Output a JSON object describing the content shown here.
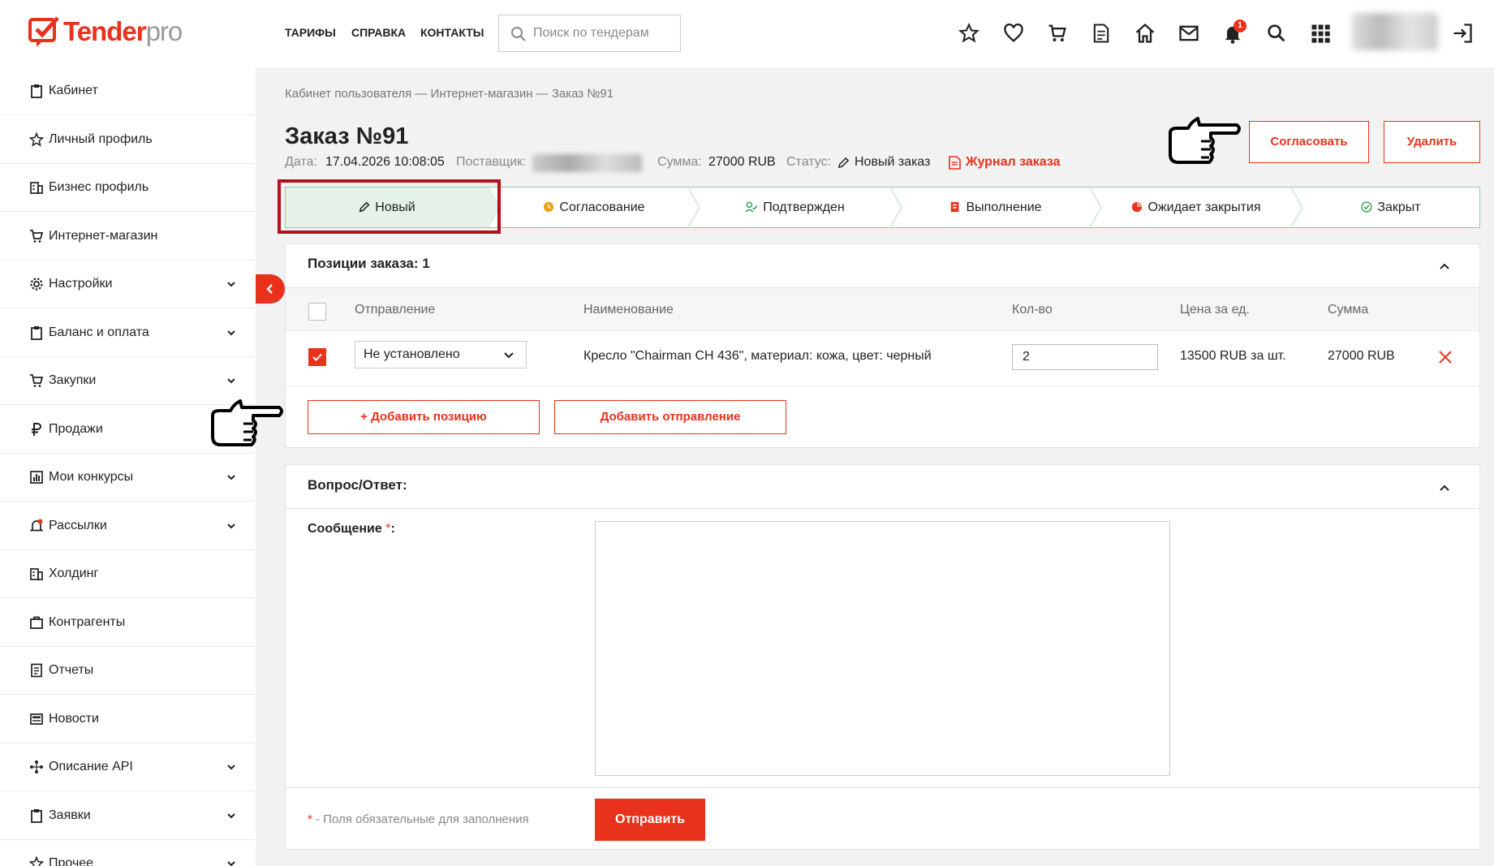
{
  "header": {
    "logo_main": "Tender",
    "logo_suffix": "pro",
    "nav": [
      "ТАРИФЫ",
      "СПРАВКА",
      "КОНТАКТЫ"
    ],
    "search_placeholder": "Поиск по тендерам",
    "notification_count": "1",
    "icons": [
      "star-icon",
      "heart-icon",
      "cart-icon",
      "document-icon",
      "home-icon",
      "mail-icon",
      "bell-icon",
      "search-icon",
      "apps-grid-icon",
      "logout-icon"
    ]
  },
  "sidebar": {
    "items": [
      {
        "label": "Кабинет",
        "icon": "clipboard-icon",
        "expandable": false
      },
      {
        "label": "Личный профиль",
        "icon": "star-icon",
        "expandable": false
      },
      {
        "label": "Бизнес профиль",
        "icon": "building-icon",
        "expandable": false
      },
      {
        "label": "Интернет-магазин",
        "icon": "cart-icon",
        "expandable": false
      },
      {
        "label": "Настройки",
        "icon": "gear-icon",
        "expandable": true
      },
      {
        "label": "Баланс и оплата",
        "icon": "clipboard-icon",
        "expandable": true
      },
      {
        "label": "Закупки",
        "icon": "cart-icon",
        "expandable": true
      },
      {
        "label": "Продажи",
        "icon": "ruble-icon",
        "expandable": true
      },
      {
        "label": "Мои конкурсы",
        "icon": "chart-icon",
        "expandable": true
      },
      {
        "label": "Рассылки",
        "icon": "bell-icon",
        "expandable": true
      },
      {
        "label": "Холдинг",
        "icon": "building-icon",
        "expandable": false
      },
      {
        "label": "Контрагенты",
        "icon": "briefcase-icon",
        "expandable": false
      },
      {
        "label": "Отчеты",
        "icon": "report-icon",
        "expandable": false
      },
      {
        "label": "Новости",
        "icon": "news-icon",
        "expandable": false
      },
      {
        "label": "Описание API",
        "icon": "api-icon",
        "expandable": true
      },
      {
        "label": "Заявки",
        "icon": "clipboard-icon",
        "expandable": true
      },
      {
        "label": "Прочее",
        "icon": "star-icon",
        "expandable": true
      }
    ]
  },
  "breadcrumb": "Кабинет пользователя — Интернет-магазин — Заказ №91",
  "order": {
    "title": "Заказ №91",
    "date_label": "Дата:",
    "date_value": "17.04.2026 10:08:05",
    "supplier_label": "Поставщик:",
    "sum_label": "Сумма:",
    "sum_value": "27000 RUB",
    "status_label": "Статус:",
    "status_value": "Новый заказ",
    "journal_link": "Журнал заказа"
  },
  "actions": {
    "approve": "Согласовать",
    "delete": "Удалить"
  },
  "steps": [
    {
      "label": "Новый",
      "icon": "pencil-icon",
      "active": true
    },
    {
      "label": "Согласование",
      "icon": "clock-icon",
      "active": false
    },
    {
      "label": "Подтвержден",
      "icon": "user-check-icon",
      "active": false
    },
    {
      "label": "Выполнение",
      "icon": "progress-icon",
      "active": false
    },
    {
      "label": "Ожидает закрытия",
      "icon": "pie-icon",
      "active": false
    },
    {
      "label": "Закрыт",
      "icon": "check-circle-icon",
      "active": false
    }
  ],
  "positions": {
    "title": "Позиции заказа: 1",
    "columns": {
      "shipment": "Отправление",
      "name": "Наименование",
      "qty": "Кол-во",
      "price": "Цена за ед.",
      "sum": "Сумма"
    },
    "rows": [
      {
        "checked": true,
        "shipment": "Не установлено",
        "name": "Кресло \"Chairman CH 436\", материал: кожа, цвет: черный",
        "qty": "2",
        "price": "13500 RUB за шт.",
        "sum": "27000 RUB"
      }
    ],
    "add_position": "+ Добавить позицию",
    "add_shipment": "Добавить отправление"
  },
  "qa": {
    "title": "Вопрос/Ответ:",
    "message_label": "Сообщение",
    "required_mark": "*",
    "required_suffix": ":",
    "footnote_mark": "*",
    "footnote_text": " - Поля обязательные для заполнения",
    "submit": "Отправить"
  },
  "colors": {
    "accent": "#e8321c",
    "active_step_bg": "#e4f2e8",
    "step_border": "#8fcca0",
    "highlight_frame": "#b0121b"
  }
}
